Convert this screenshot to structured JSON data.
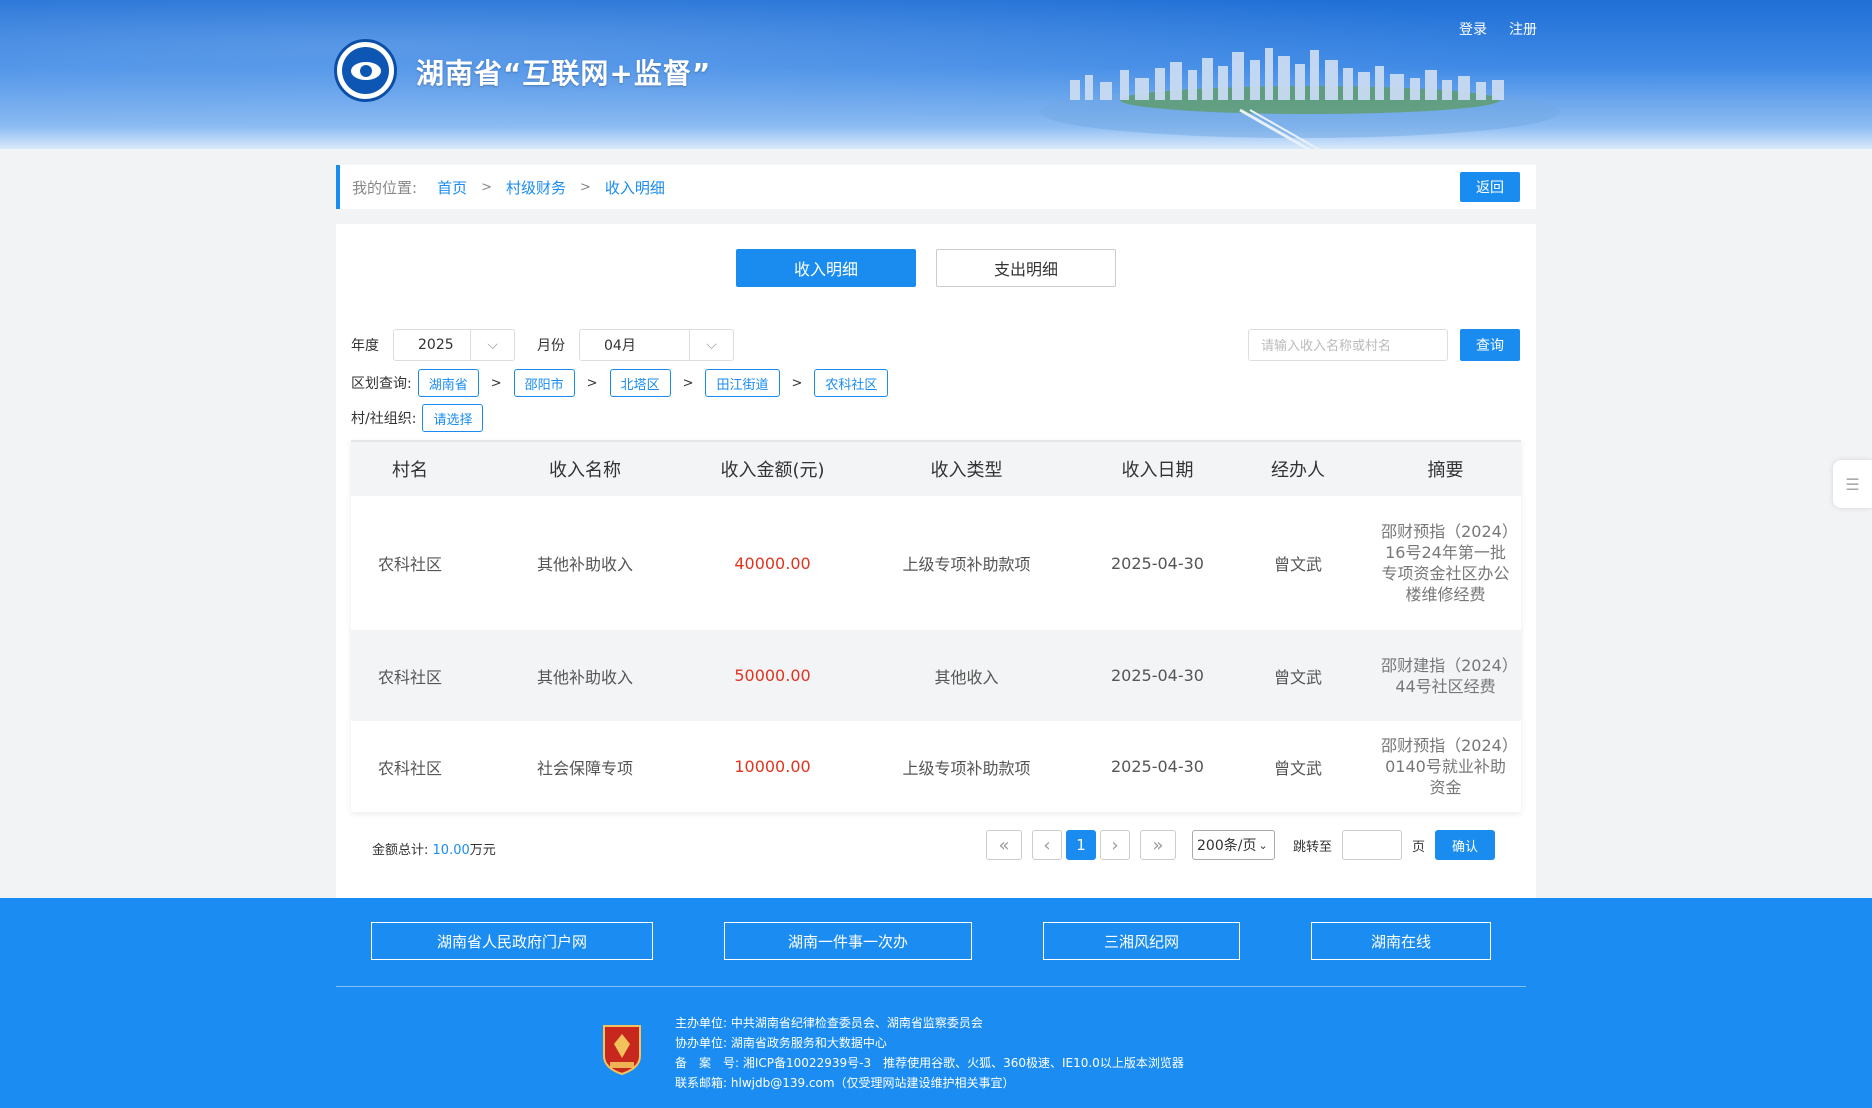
{
  "header": {
    "site_title": "湖南省“互联网+监督”",
    "login": "登录",
    "register": "注册"
  },
  "breadcrumb": {
    "label": "我的位置:",
    "items": [
      "首页",
      "村级财务",
      "收入明细"
    ],
    "separator": ">",
    "back": "返回"
  },
  "tabs": [
    {
      "label": "收入明细",
      "active": true
    },
    {
      "label": "支出明细",
      "active": false
    }
  ],
  "filters": {
    "year_label": "年度",
    "year_value": "2025",
    "month_label": "月份",
    "month_value": "04月",
    "search_placeholder": "请输入收入名称或村名",
    "query": "查询",
    "region_label": "区划查询:",
    "regions": [
      "湖南省",
      "邵阳市",
      "北塔区",
      "田江街道",
      "农科社区"
    ],
    "org_label": "村/社组织:",
    "org_value": "请选择"
  },
  "table": {
    "headers": [
      "村名",
      "收入名称",
      "收入金额(元)",
      "收入类型",
      "收入日期",
      "经办人",
      "摘要"
    ],
    "rows": [
      [
        "农科社区",
        "其他补助收入",
        "40000.00",
        "上级专项补助款项",
        "2025-04-30",
        "曾文武",
        "邵财预指（2024）16号24年第一批专项资金社区办公楼维修经费"
      ],
      [
        "农科社区",
        "其他补助收入",
        "50000.00",
        "其他收入",
        "2025-04-30",
        "曾文武",
        "邵财建指（2024）44号社区经费"
      ],
      [
        "农科社区",
        "社会保障专项",
        "10000.00",
        "上级专项补助款项",
        "2025-04-30",
        "曾文武",
        "邵财预指（2024）0140号就业补助资金"
      ]
    ]
  },
  "summary": {
    "label": "金额总计:",
    "value": "10.00",
    "unit": "万元"
  },
  "pagination": {
    "first": "«",
    "prev": "‹",
    "current": "1",
    "next": "›",
    "last": "»",
    "page_size": "200条/页",
    "goto_label": "跳转至",
    "page_unit": "页",
    "confirm": "确认"
  },
  "side_float": {
    "icon": "list-icon"
  },
  "footer": {
    "links": [
      "湖南省人民政府门户网",
      "湖南一件事一次办",
      "三湘风纪网",
      "湖南在线"
    ],
    "host_label": "主办单位:",
    "host": "中共湖南省纪律检查委员会、湖南省监察委员会",
    "co_label": "协办单位:",
    "co": "湖南省政务服务和大数据中心",
    "icp_label": "备　案　号:",
    "icp": "湘ICP备10022939号-3　推荐使用谷歌、火狐、360极速、IE10.0以上版本浏览器",
    "email_label": "联系邮箱:",
    "email": "hlwjdb@139.com（仅受理网站建设维护相关事宜）",
    "badge_text": "党政机关"
  },
  "colors": {
    "accent": "#1a8cf0",
    "amount": "#e0341e",
    "footer_bg": "#1b8df2"
  }
}
